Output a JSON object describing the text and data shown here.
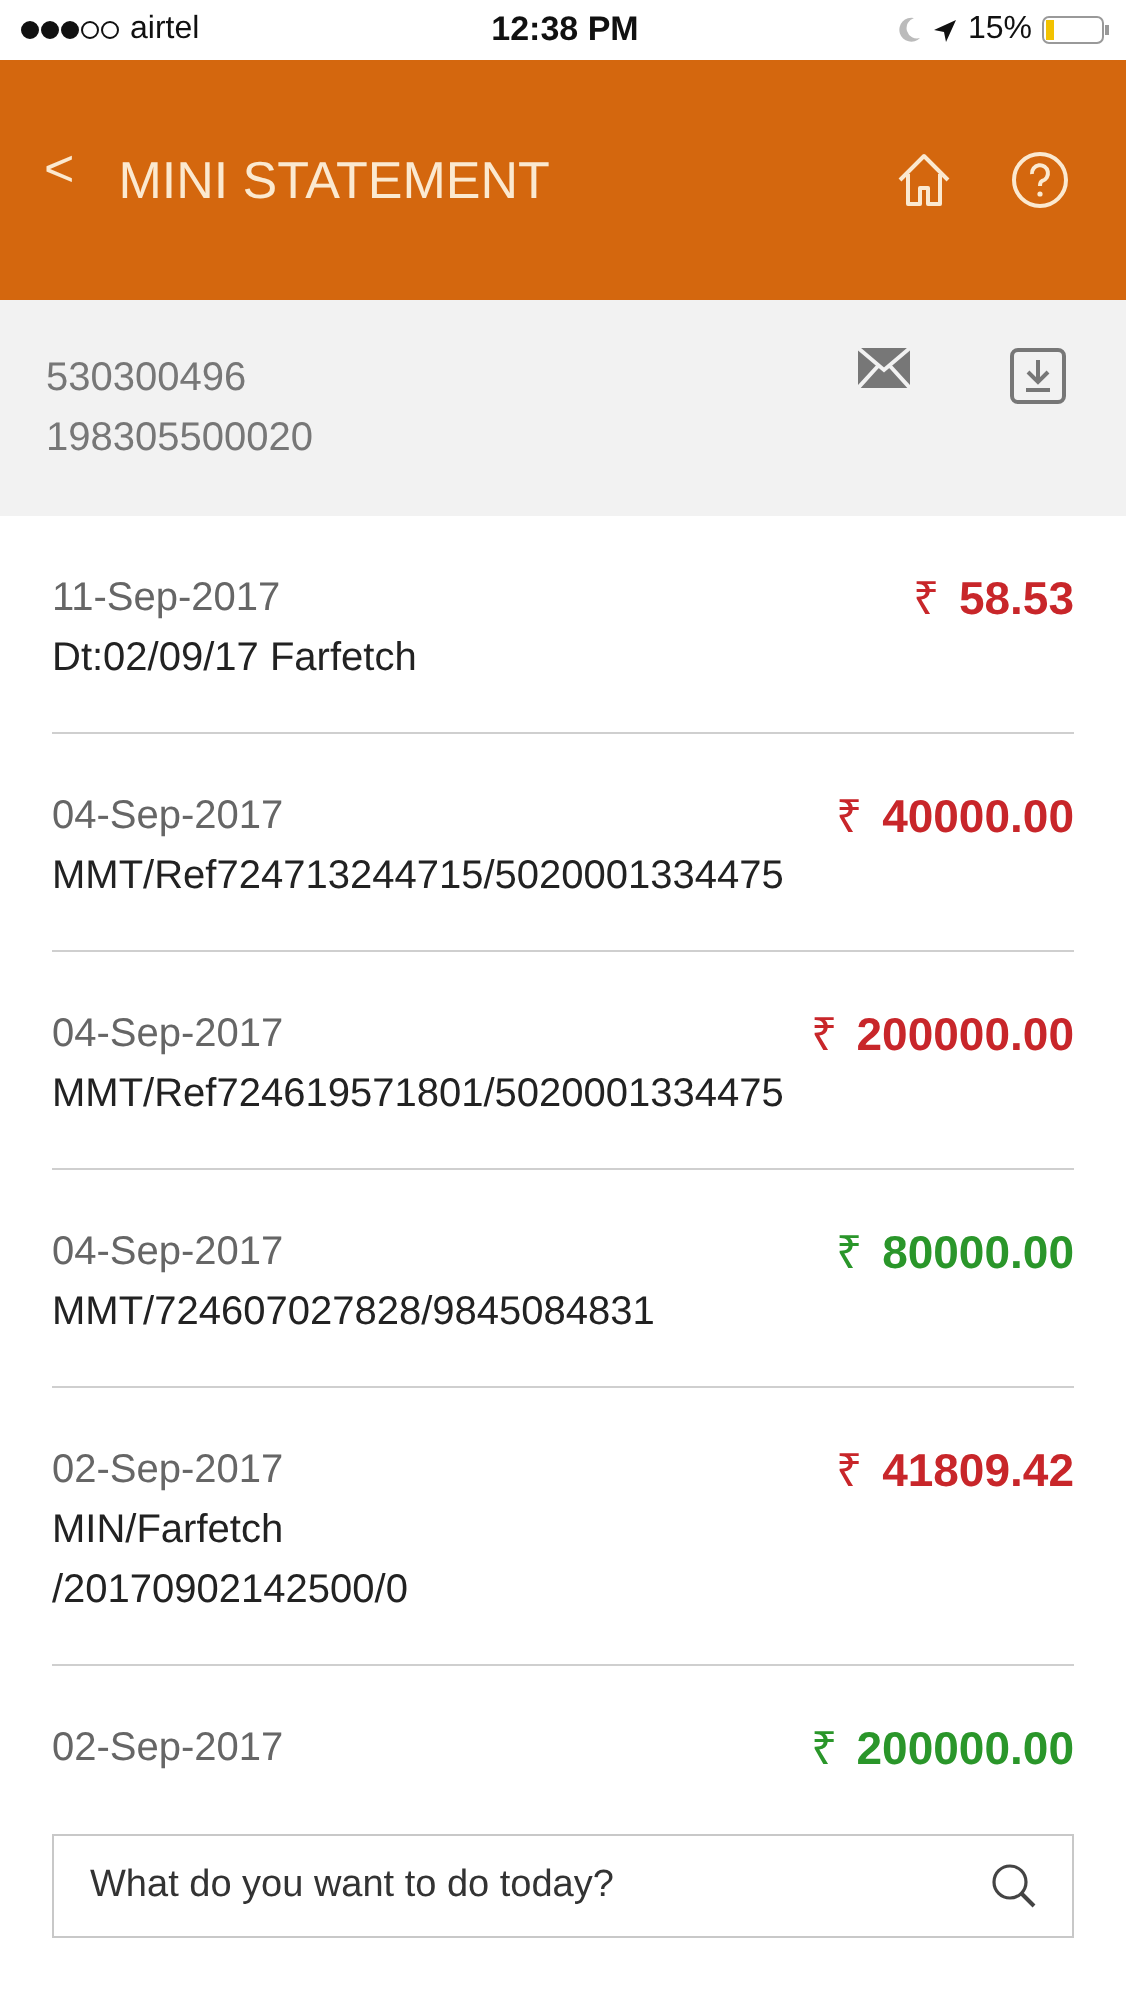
{
  "status_bar": {
    "carrier": "airtel",
    "time": "12:38 PM",
    "battery": "15%"
  },
  "header": {
    "back": "<",
    "title": "MINI STATEMENT"
  },
  "account": {
    "lines": [
      "530300496",
      "198305500020"
    ]
  },
  "transactions": [
    {
      "date": "11-Sep-2017",
      "description": [
        "Dt:02/09/17 Farfetch"
      ],
      "currency": "₹",
      "amount": "58.53",
      "kind": "debit"
    },
    {
      "date": "04-Sep-2017",
      "description": [
        "MMT/Ref724713244715/5020001334475"
      ],
      "currency": "₹",
      "amount": "40000.00",
      "kind": "debit"
    },
    {
      "date": "04-Sep-2017",
      "description": [
        "MMT/Ref724619571801/5020001334475"
      ],
      "currency": "₹",
      "amount": "200000.00",
      "kind": "debit"
    },
    {
      "date": "04-Sep-2017",
      "description": [
        "MMT/724607027828/9845084831"
      ],
      "currency": "₹",
      "amount": "80000.00",
      "kind": "credit"
    },
    {
      "date": "02-Sep-2017",
      "description": [
        "MIN/Farfetch",
        "/20170902142500/0"
      ],
      "currency": "₹",
      "amount": "41809.42",
      "kind": "debit"
    },
    {
      "date": "02-Sep-2017",
      "currency": "₹",
      "amount": "200000.00",
      "kind": "credit"
    }
  ],
  "search": {
    "placeholder": "What do you want to do today?"
  }
}
